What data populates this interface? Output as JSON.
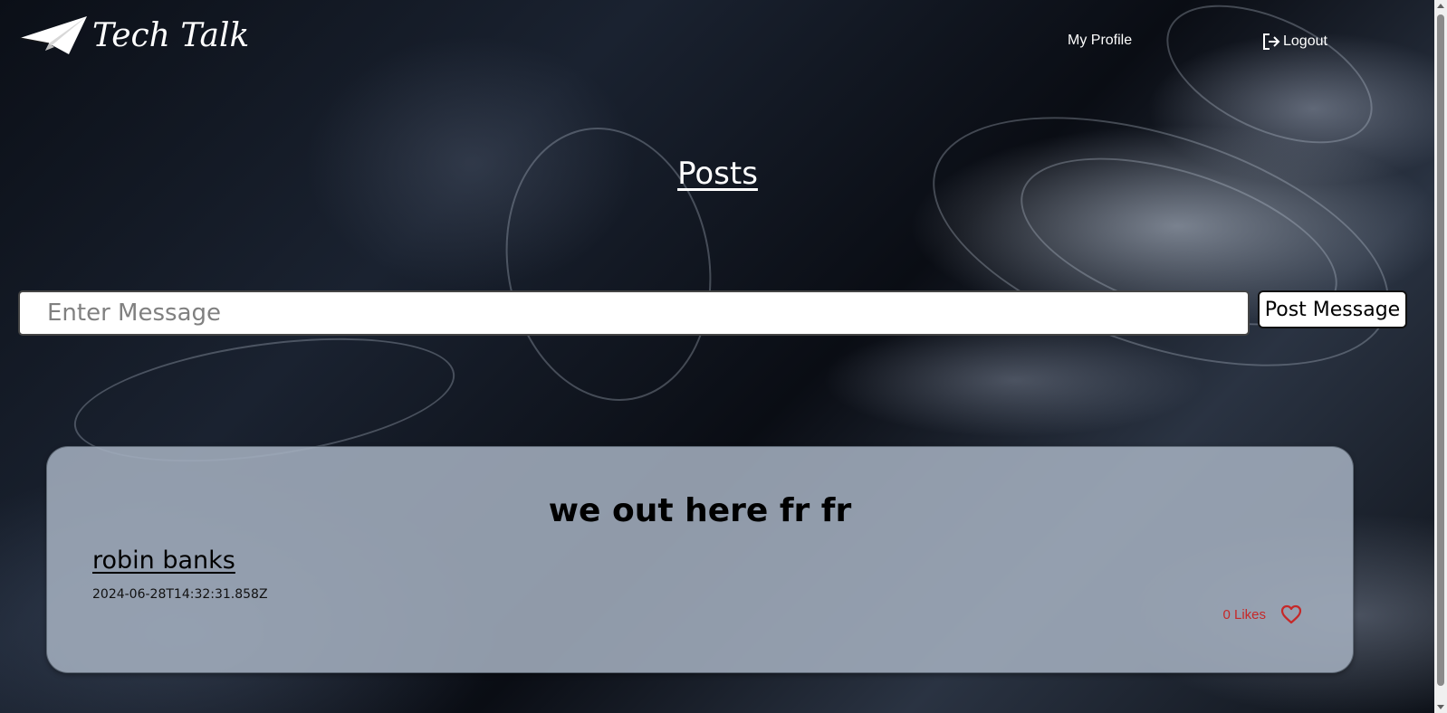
{
  "app": {
    "logo_text": "Tech Talk",
    "logo_icon": "paper-plane-icon"
  },
  "nav": {
    "profile_label": "My Profile",
    "logout_label": "Logout",
    "logout_icon": "logout-icon"
  },
  "page": {
    "title": "Posts"
  },
  "composer": {
    "placeholder": "Enter Message",
    "value": "",
    "button_label": "Post Message"
  },
  "posts": [
    {
      "body": "we out here fr fr",
      "author": "robin banks",
      "timestamp": "2024-06-28T14:32:31.858Z",
      "likes_label": "0 Likes",
      "like_icon": "heart-outline-icon"
    }
  ],
  "colors": {
    "likes_red": "#c62828",
    "card_bg": "#a3aebe"
  }
}
